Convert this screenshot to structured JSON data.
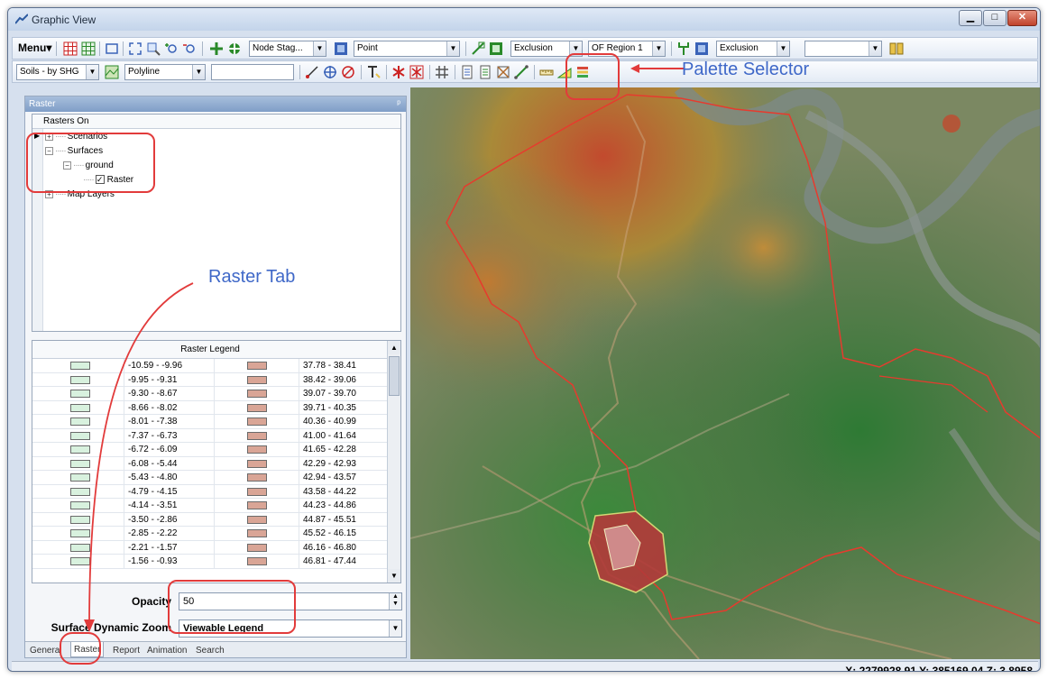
{
  "window": {
    "title": "Graphic View"
  },
  "toolbar1": {
    "menu_label": "Menu",
    "node_combo": "Node Stag...",
    "point_combo": "Point",
    "exclusion_combo_1": "Exclusion",
    "region_combo": "OF Region 1",
    "exclusion_combo_2": "Exclusion",
    "blank_combo": ""
  },
  "toolbar2": {
    "soils_combo": "Soils - by SHG",
    "polyline_combo": "Polyline",
    "text_field": ""
  },
  "panel": {
    "title": "Raster",
    "tree_header": "Rasters On",
    "tree_items": [
      "Scenarios",
      "Surfaces",
      "ground",
      "Raster",
      "Map Layers"
    ]
  },
  "legend": {
    "title": "Raster Legend",
    "left_color": "#d8f1de",
    "right_color": "#d9a596",
    "rows": [
      {
        "left": "-10.59 - -9.96",
        "right": "37.78 - 38.41"
      },
      {
        "left": "-9.95 - -9.31",
        "right": "38.42 - 39.06"
      },
      {
        "left": "-9.30 - -8.67",
        "right": "39.07 - 39.70"
      },
      {
        "left": "-8.66 - -8.02",
        "right": "39.71 - 40.35"
      },
      {
        "left": "-8.01 - -7.38",
        "right": "40.36 - 40.99"
      },
      {
        "left": "-7.37 - -6.73",
        "right": "41.00 - 41.64"
      },
      {
        "left": "-6.72 - -6.09",
        "right": "41.65 - 42.28"
      },
      {
        "left": "-6.08 - -5.44",
        "right": "42.29 - 42.93"
      },
      {
        "left": "-5.43 - -4.80",
        "right": "42.94 - 43.57"
      },
      {
        "left": "-4.79 - -4.15",
        "right": "43.58 - 44.22"
      },
      {
        "left": "-4.14 - -3.51",
        "right": "44.23 - 44.86"
      },
      {
        "left": "-3.50 - -2.86",
        "right": "44.87 - 45.51"
      },
      {
        "left": "-2.85 - -2.22",
        "right": "45.52 - 46.15"
      },
      {
        "left": "-2.21 - -1.57",
        "right": "46.16 - 46.80"
      },
      {
        "left": "-1.56 - -0.93",
        "right": "46.81 - 47.44"
      }
    ]
  },
  "properties": {
    "opacity_label": "Opacity",
    "opacity_value": "50",
    "zoom_label": "Surface Dynamic Zoom",
    "zoom_value": "Viewable Legend"
  },
  "tabs": [
    "General",
    "Raster",
    "Report",
    "Animation",
    "Search"
  ],
  "status": {
    "coords": "X: 2279928.91  Y: 385169.04  Z: 3.8958"
  },
  "annotations": {
    "palette": "Palette Selector",
    "raster_tab": "Raster Tab"
  }
}
